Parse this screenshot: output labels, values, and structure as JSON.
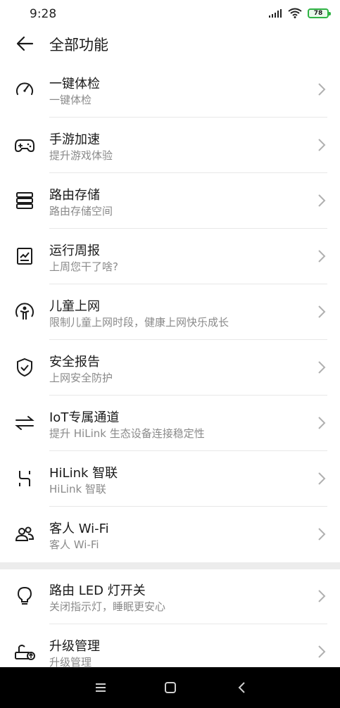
{
  "status_bar": {
    "time": "9:28",
    "battery": "78"
  },
  "header": {
    "title": "全部功能"
  },
  "items": [
    {
      "title": "一键体检",
      "subtitle": "一键体检",
      "icon": "speedometer-icon"
    },
    {
      "title": "手游加速",
      "subtitle": "提升游戏体验",
      "icon": "gamepad-icon"
    },
    {
      "title": "路由存储",
      "subtitle": "路由存储空间",
      "icon": "storage-icon"
    },
    {
      "title": "运行周报",
      "subtitle": "上周您干了啥?",
      "icon": "report-chart-icon"
    },
    {
      "title": "儿童上网",
      "subtitle": "限制儿童上网时段，健康上网快乐成长",
      "icon": "child-icon"
    },
    {
      "title": "安全报告",
      "subtitle": "上网安全防护",
      "icon": "shield-check-icon"
    },
    {
      "title": "IoT专属通道",
      "subtitle": "提升 HiLink 生态设备连接稳定性",
      "icon": "transfer-arrows-icon"
    },
    {
      "title": "HiLink 智联",
      "subtitle": "HiLink 智联",
      "icon": "hilink-icon"
    },
    {
      "title": "客人 Wi-Fi",
      "subtitle": "客人 Wi-Fi",
      "icon": "guests-icon"
    }
  ],
  "items2": [
    {
      "title": "路由 LED 灯开关",
      "subtitle": "关闭指示灯，睡眠更安心",
      "icon": "lightbulb-icon"
    },
    {
      "title": "升级管理",
      "subtitle": "升级管理",
      "icon": "router-upgrade-icon"
    }
  ]
}
